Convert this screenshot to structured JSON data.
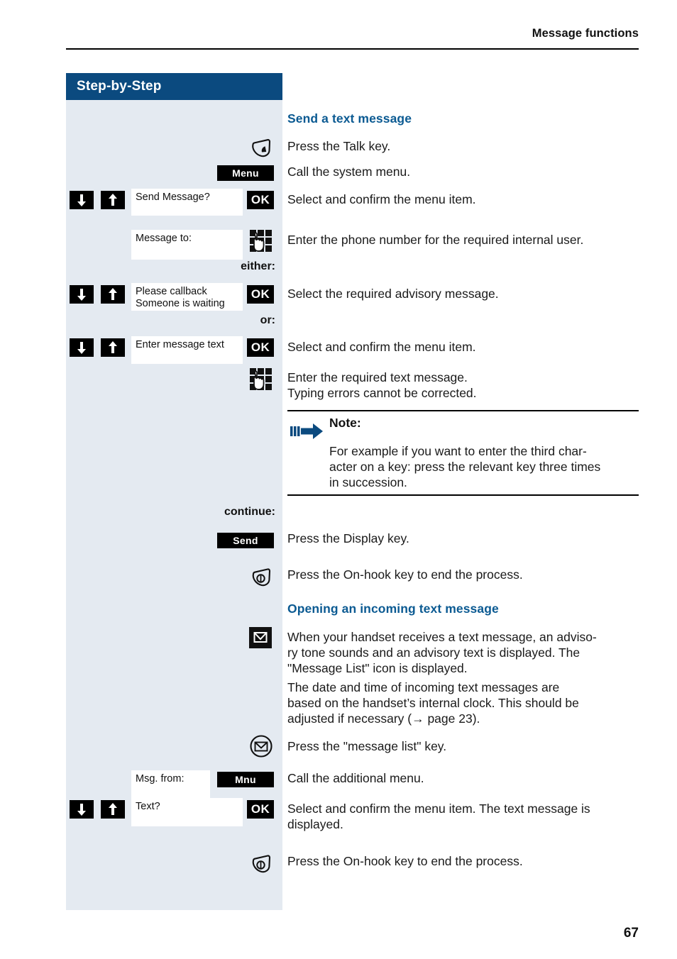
{
  "document": {
    "running_head": "Message functions",
    "page_number": "67",
    "accent_color": "#0b4a7f",
    "heading_color": "#0b5a92",
    "sidebar_color": "#e4eaf1"
  },
  "sidebar": {
    "title": "Step-by-Step"
  },
  "sections": {
    "send_text_message": {
      "heading": "Send a text message",
      "steps": [
        {
          "icon": "talk-key-icon",
          "text": "Press the Talk key."
        },
        {
          "softkey": "Menu",
          "text": "Call the system menu."
        },
        {
          "display": [
            "Send Message?"
          ],
          "ok": "OK",
          "nav": true,
          "text": "Select and confirm the menu item."
        },
        {
          "display": [
            "Message to:"
          ],
          "icon": "keypad-icon",
          "text": "Enter the phone number for the required internal user."
        }
      ],
      "either_label": "either:",
      "or_label": "or:",
      "continue_label": "continue:",
      "branch_a": {
        "display": [
          "Please callback",
          "Someone is waiting"
        ],
        "ok": "OK",
        "nav": true,
        "text": "Select the required advisory message."
      },
      "branch_b": {
        "display": [
          "Enter message text"
        ],
        "ok": "OK",
        "nav": true,
        "text": "Select and confirm the menu item."
      },
      "enter_text": {
        "icon": "keypad-icon",
        "line1": "Enter the required text message.",
        "line2": "Typing errors cannot be corrected."
      },
      "note": {
        "title": "Note:",
        "line1": "For example  if you want to enter the third char-",
        "line2": "acter on a key: press the relevant key three times",
        "line3": "in succession."
      },
      "after_continue": [
        {
          "softkey": "Send",
          "text": "Press the Display key."
        },
        {
          "icon": "on-hook-key-icon",
          "text": "Press the On-hook key to end the process."
        }
      ]
    },
    "opening_incoming": {
      "heading": "Opening an incoming text message",
      "intro_icon": "message-list-filled-icon",
      "intro_lines": [
        "When your handset receives a text message, an adviso-",
        "ry tone sounds and an advisory text is displayed. The",
        "\"Message List\" icon is displayed.",
        "The date and time of incoming text messages are",
        "based on the handset’s internal clock. This should be",
        "adjusted if necessary (→ page 23)."
      ],
      "steps": [
        {
          "icon": "message-list-key-icon",
          "text": "Press the \"message list\" key."
        },
        {
          "display": [
            "Msg. from:"
          ],
          "softkey": "Mnu",
          "text": "Call the additional menu."
        },
        {
          "display": [
            "Text?"
          ],
          "ok": "OK",
          "nav": true,
          "line1": "Select and confirm the menu item. The text message is",
          "line2": "displayed."
        },
        {
          "icon": "on-hook-key-icon",
          "text": "Press the On-hook key to end the process."
        }
      ]
    }
  }
}
